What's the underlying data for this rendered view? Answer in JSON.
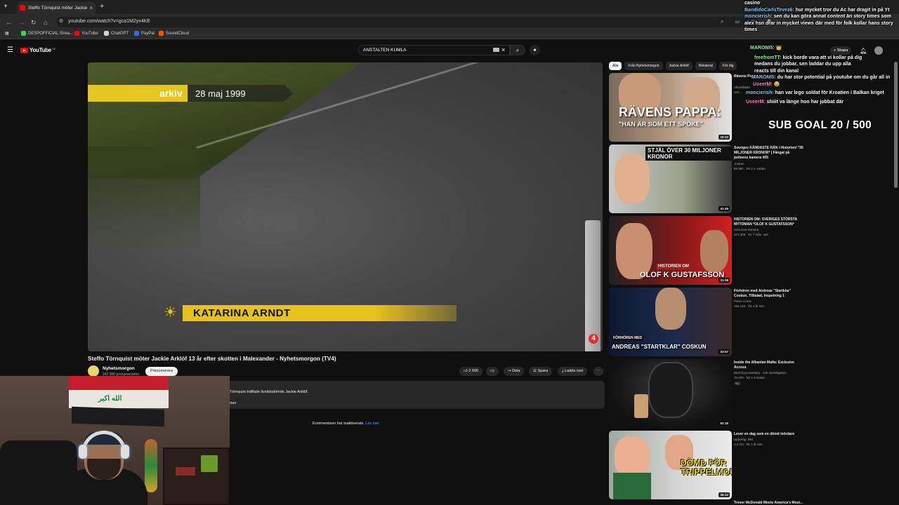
{
  "browser": {
    "tab_title": "Steffo Törnquist möter Jackie A",
    "url": "youtube.com/watch?v=gca1M2yx4KE",
    "bookmarks": [
      {
        "label": "DESPOFFICIAL Strea...",
        "color": "#39d353"
      },
      {
        "label": "YouTube",
        "color": "#ff0000"
      },
      {
        "label": "ChatGPT",
        "color": "#d0d0d0"
      },
      {
        "label": "PayPal",
        "color": "#2f6fde"
      },
      {
        "label": "SoundCloud",
        "color": "#ff5500"
      }
    ]
  },
  "youtube": {
    "logo_text": "YouTube",
    "country_code": "SE",
    "search_query": "ANSTALTEN KUMLA",
    "create_label": "Skapa"
  },
  "video": {
    "overlay_arkiv": "arkiv",
    "overlay_date": "28 maj 1999",
    "overlay_name": "KATARINA ARNDT",
    "title": "Steffo Törnquist möter Jackie Arklöf 13 år efter skotten i Malexander - Nyhetsmorgon (TV4)",
    "channel": "Nyhetsmorgon",
    "subscribers": "242 000 prenumeranter",
    "subscribe_label": "Prenumerera",
    "likes": "2 605",
    "share_label": "Dela",
    "save_label": "Spara",
    "download_label": "Ladda ned",
    "description": "Törnquist träffade livstidsdömde Jackie Arklöf.",
    "description_more": "mer",
    "comments_off": "Kommentarer har inaktiverats.",
    "learn_more": "Läs mer"
  },
  "chips": [
    "Alla",
    "Från Nyhetsmorgon",
    "Jackie Arklöf",
    "Relaterat",
    "För dig"
  ],
  "recommendations": [
    {
      "title": "Rävens Pappa",
      "channel": "Aftonbladet",
      "meta": "122 ...",
      "duration": "10:23",
      "thumb_text": "RÄVENS PAPPA:",
      "thumb_sub": "\"HAN ÄR SOM ETT SPÖKE\""
    },
    {
      "title": "Sveriges KÄNDASTE RÅN i Historien! *30 MILJONER KRONOR* | Fångat på polisens kamera #55",
      "channel": "Jonkan",
      "meta": "86 887 · för 2 v. sedan",
      "duration": "41:49",
      "thumb_text": "STJÄL ÖVER 30 MILJONER KRONOR"
    },
    {
      "title": "HISTORIEN OM: SVERIGES STÖRSTA MYTOMAN *OLOF K GUSTAFSSON*",
      "channel": "Anis Don Demina",
      "meta": "571 308 · för 7 mån. sen",
      "duration": "31:08",
      "thumb_text": "OLOF K GUSTAFSSON",
      "thumb_sub": "HISTORIEN OM"
    },
    {
      "title": "Förhören med Andreas \"Startklar\" Coskun, Tilltalad, Inspelning 1",
      "channel": "Prime Crime",
      "meta": "194 120 · för 4 år sen",
      "duration": "33:57",
      "thumb_text": "ANDREAS \"STARTKLAR\" COSKUN",
      "thumb_sub": "FÖRHÖREN MED"
    },
    {
      "title": "Inside the Albanian Mafia: Exclusive Access",
      "channel": "Best Documentary · ooh investigation",
      "meta": "70 072 · för 2 d sedan",
      "duration": "52:18",
      "badge": "Ny"
    },
    {
      "title": "Lever en dag som en dömd mördare",
      "channel": "Uppdrag: Mel",
      "meta": "1,2 mn · för 1 år sen",
      "duration": "36:12",
      "thumb_text": "DÖMD FÖR TRIPPELMORD"
    }
  ],
  "bottom_peek": "Trevor McDonald Meets America's Most...",
  "chat": {
    "top_lines": [
      {
        "user": "",
        "text": "casino"
      },
      {
        "user": "BandidoCarlsTevez6:",
        "text": "hur mycket tror du Ac har dragit in på Yt"
      },
      {
        "user": "moncierish:",
        "text": "sen du kan göra annat content än story times som alex hsn drar in mycket views där med för folk kollar hans story times"
      }
    ],
    "lines": [
      {
        "user": "MARONI5:",
        "text": "",
        "cls": "g"
      },
      {
        "user": "freefromTT:",
        "text": "kick borde vara att vi kollar på dig medans du jobbar, sen laddar du upp alla reacts till din kanal",
        "cls": "g"
      },
      {
        "user": "MARONI5:",
        "text": "du har stor potential på youtube om du går all in",
        "cls": ""
      },
      {
        "user": "UseerM:",
        "text": "",
        "cls": "p"
      },
      {
        "user": "moncierish:",
        "text": "han var lego soldat för Kroatien i Balkan kriget",
        "cls": ""
      },
      {
        "user": "UseerM:",
        "text": "shiiit va länge hon har jobbat där",
        "cls": "p"
      }
    ],
    "sub_goal": "SUB GOAL 20 / 500"
  }
}
